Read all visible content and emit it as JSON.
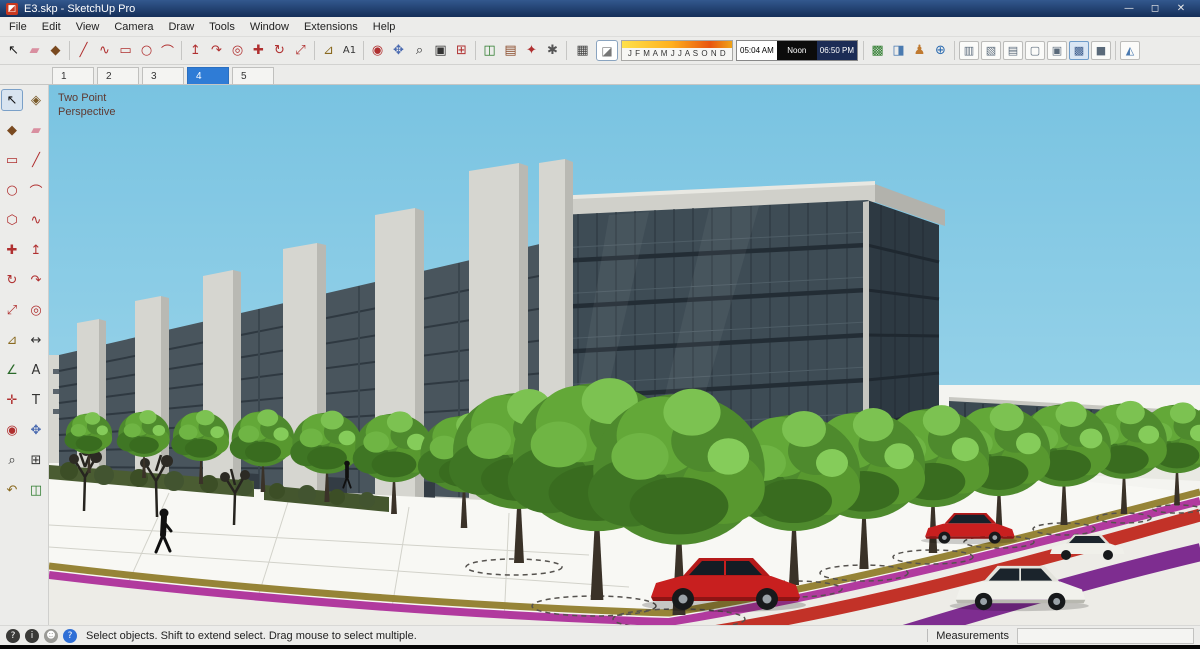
{
  "window": {
    "title": "E3.skp - SketchUp Pro",
    "logo_glyph": "◩",
    "minimize_glyph": "—",
    "maximize_glyph": "◻",
    "close_glyph": "✕"
  },
  "menu": {
    "items": [
      "File",
      "Edit",
      "View",
      "Camera",
      "Draw",
      "Tools",
      "Window",
      "Extensions",
      "Help"
    ]
  },
  "toolbar": {
    "icons": [
      {
        "name": "select",
        "glyph": "↖"
      },
      {
        "name": "eraser",
        "glyph": "▰"
      },
      {
        "name": "paint-bucket",
        "glyph": "◆"
      },
      {
        "name": "line",
        "glyph": "╱"
      },
      {
        "name": "freehand",
        "glyph": "∿"
      },
      {
        "name": "rectangle",
        "glyph": "▭"
      },
      {
        "name": "circle",
        "glyph": "○"
      },
      {
        "name": "arc",
        "glyph": "⌒"
      },
      {
        "name": "push-pull",
        "glyph": "↥"
      },
      {
        "name": "follow-me",
        "glyph": "↷"
      },
      {
        "name": "offset",
        "glyph": "◎"
      },
      {
        "name": "move",
        "glyph": "✚"
      },
      {
        "name": "rotate",
        "glyph": "↻"
      },
      {
        "name": "scale",
        "glyph": "⤢"
      },
      {
        "name": "tape-measure",
        "glyph": "⊿"
      },
      {
        "name": "dimension",
        "glyph": "A1"
      },
      {
        "name": "orbit",
        "glyph": "◉"
      },
      {
        "name": "pan",
        "glyph": "✥"
      },
      {
        "name": "zoom",
        "glyph": "⌕"
      },
      {
        "name": "zoom-window",
        "glyph": "▣"
      },
      {
        "name": "zoom-extents",
        "glyph": "⊞"
      },
      {
        "name": "section-plane",
        "glyph": "◫"
      },
      {
        "name": "3d-warehouse",
        "glyph": "▤"
      },
      {
        "name": "extension-warehouse",
        "glyph": "✦"
      },
      {
        "name": "model-info",
        "glyph": "✱"
      }
    ],
    "shadow": {
      "dialog_glyph": "▦",
      "toggle_glyph": "◪",
      "months": "J F M A M J J A S O N D",
      "time_start": "05:04 AM",
      "time_noon": "Noon",
      "time_end": "06:50 PM"
    },
    "location_icons": [
      {
        "name": "get-location",
        "glyph": "▩"
      },
      {
        "name": "photo-textures",
        "glyph": "◨"
      },
      {
        "name": "add-person",
        "glyph": "♟"
      },
      {
        "name": "globe",
        "glyph": "⊕"
      }
    ],
    "style_icons": [
      {
        "name": "style-xray",
        "glyph": "▥"
      },
      {
        "name": "style-back-edges",
        "glyph": "▧"
      },
      {
        "name": "style-wireframe",
        "glyph": "▤"
      },
      {
        "name": "style-hidden-line",
        "glyph": "▢"
      },
      {
        "name": "style-shaded",
        "glyph": "▣"
      },
      {
        "name": "style-shaded-textures",
        "glyph": "▩"
      },
      {
        "name": "style-monochrome",
        "glyph": "■"
      },
      {
        "name": "view-iso",
        "glyph": "◭"
      }
    ]
  },
  "scene_tabs": {
    "tabs": [
      "1",
      "2",
      "3",
      "4",
      "5"
    ],
    "active": "4"
  },
  "palette": {
    "tools": [
      {
        "name": "select",
        "glyph": "↖"
      },
      {
        "name": "make-component",
        "glyph": "◈"
      },
      {
        "name": "paint-bucket",
        "glyph": "◆"
      },
      {
        "name": "eraser",
        "glyph": "▰"
      },
      {
        "name": "rectangle",
        "glyph": "▭"
      },
      {
        "name": "line",
        "glyph": "╱"
      },
      {
        "name": "circle",
        "glyph": "○"
      },
      {
        "name": "arc",
        "glyph": "⌒"
      },
      {
        "name": "polygon",
        "glyph": "⬡"
      },
      {
        "name": "freehand",
        "glyph": "∿"
      },
      {
        "name": "move",
        "glyph": "✚"
      },
      {
        "name": "push-pull",
        "glyph": "↥"
      },
      {
        "name": "rotate",
        "glyph": "↻"
      },
      {
        "name": "follow-me",
        "glyph": "↷"
      },
      {
        "name": "scale",
        "glyph": "⤢"
      },
      {
        "name": "offset",
        "glyph": "◎"
      },
      {
        "name": "tape-measure",
        "glyph": "⊿"
      },
      {
        "name": "dimension",
        "glyph": "↔"
      },
      {
        "name": "protractor",
        "glyph": "∠"
      },
      {
        "name": "text",
        "glyph": "A"
      },
      {
        "name": "axes",
        "glyph": "✛"
      },
      {
        "name": "3d-text",
        "glyph": "T"
      },
      {
        "name": "orbit",
        "glyph": "◉"
      },
      {
        "name": "pan",
        "glyph": "✥"
      },
      {
        "name": "zoom",
        "glyph": "⌕"
      },
      {
        "name": "zoom-extents",
        "glyph": "⊞"
      },
      {
        "name": "previous-view",
        "glyph": "↶"
      },
      {
        "name": "section-plane",
        "glyph": "◫"
      }
    ]
  },
  "viewport": {
    "camera_label_line1": "Two Point",
    "camera_label_line2": "Perspective"
  },
  "statusbar": {
    "help_glyph": "?",
    "info_glyph": "i",
    "person_glyph": "☻",
    "question_glyph": "?",
    "message": "Select objects. Sh­ift to extend select. Drag mouse to select multiple.",
    "measurements_label": "Measurements",
    "measurements_value": ""
  },
  "colors": {
    "active_tab": "#2f7cd6",
    "sky": "#8ed0e8",
    "accent_red": "#b03030",
    "shadow_gradient": "#ffe14a #ffb01e #e85510"
  }
}
